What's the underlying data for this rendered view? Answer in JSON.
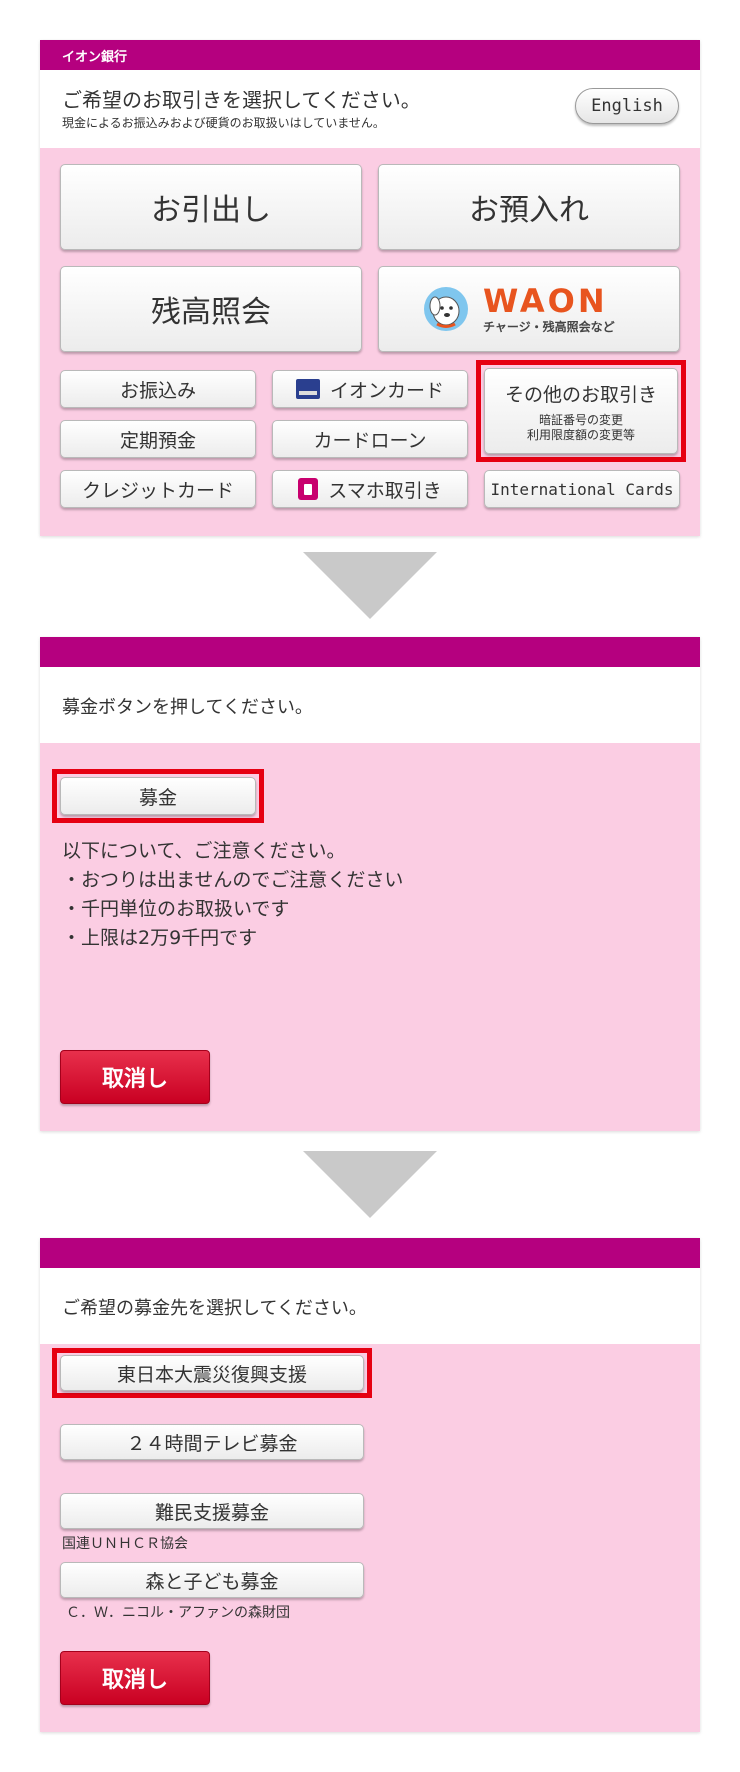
{
  "screen1": {
    "bank_name": "イオン銀行",
    "title": "ご希望のお取引きを選択してください。",
    "subtitle": "現金によるお振込みおよび硬貨のお取扱いはしていません。",
    "english_label": "English",
    "buttons": {
      "withdraw": "お引出し",
      "deposit": "お預入れ",
      "balance": "残高照会",
      "waon_logo": "WAON",
      "waon_sub": "チャージ・残高照会など",
      "transfer": "お振込み",
      "aeon_card": "イオンカード",
      "other": "その他のお取引き",
      "other_sub1": "暗証番号の変更",
      "other_sub2": "利用限度額の変更等",
      "time_deposit": "定期預金",
      "card_loan": "カードローン",
      "credit_card": "クレジットカード",
      "smartphone": "スマホ取引き",
      "international": "International Cards"
    }
  },
  "screen2": {
    "title": "募金ボタンを押してください。",
    "donation_button": "募金",
    "notice_heading": "以下について、ご注意ください。",
    "notices": [
      "・おつりは出ませんのでご注意ください",
      "・千円単位のお取扱いです",
      "・上限は2万9千円です"
    ],
    "cancel": "取消し"
  },
  "screen3": {
    "title": "ご希望の募金先を選択してください。",
    "options": [
      {
        "label": "東日本大震災復興支援",
        "sub": ""
      },
      {
        "label": "２４時間テレビ募金",
        "sub": ""
      },
      {
        "label": "難民支援募金",
        "sub": "国連ＵＮＨＣＲ協会"
      },
      {
        "label": "森と子ども募金",
        "sub": "Ｃ．Ｗ．ニコル・アファンの森財団"
      }
    ],
    "cancel": "取消し"
  },
  "colors": {
    "brand_magenta": "#b5007f",
    "panel_pink": "#fbcde3",
    "highlight_red": "#e60012",
    "cancel_red": "#d7002a",
    "waon_orange": "#e8541e"
  }
}
